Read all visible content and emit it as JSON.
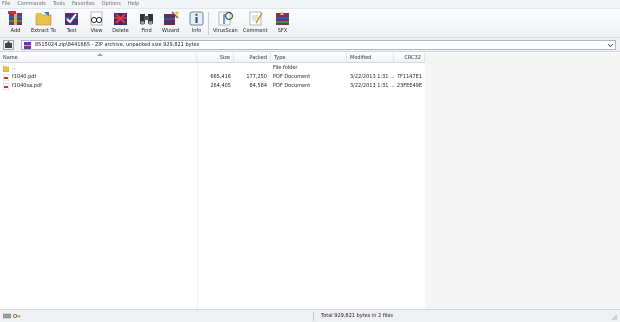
{
  "menu": [
    "File",
    "Commands",
    "Tools",
    "Favorites",
    "Options",
    "Help"
  ],
  "toolbar": {
    "add": "Add",
    "extract_to": "Extract To",
    "test": "Test",
    "view": "View",
    "delete": "Delete",
    "find": "Find",
    "wizard": "Wizard",
    "info": "Info",
    "virusscan": "VirusScan",
    "comment": "Comment",
    "sfx": "SFX"
  },
  "address": {
    "path": "8515024.zip\\8441665 - ZIP archive, unpacked size 929,821 bytes"
  },
  "columns": {
    "name": "Name",
    "size": "Size",
    "packed": "Packed",
    "type": "Type",
    "modified": "Modified",
    "crc32": "CRC32"
  },
  "rows": [
    {
      "name": "..",
      "size": "",
      "packed": "",
      "type": "File folder",
      "modified": "",
      "crc": ""
    },
    {
      "name": "f1040.pdf",
      "size": "665,416",
      "packed": "177,250",
      "type": "PDF Document",
      "modified": "3/22/2013 1:31 ...",
      "crc": "7F1147E1"
    },
    {
      "name": "f1040sa.pdf",
      "size": "264,405",
      "packed": "84,584",
      "type": "PDF Document",
      "modified": "3/22/2013 1:31 ...",
      "crc": "23FEE49E"
    }
  ],
  "status": {
    "text": "Total 929,821 bytes in 2 files"
  },
  "colors": {
    "menu_text": "#6d6d6d",
    "toolbar_bg": "#eef1f5",
    "pdf_red": "#c8342c",
    "folder_yellow": "#e8c04a"
  }
}
